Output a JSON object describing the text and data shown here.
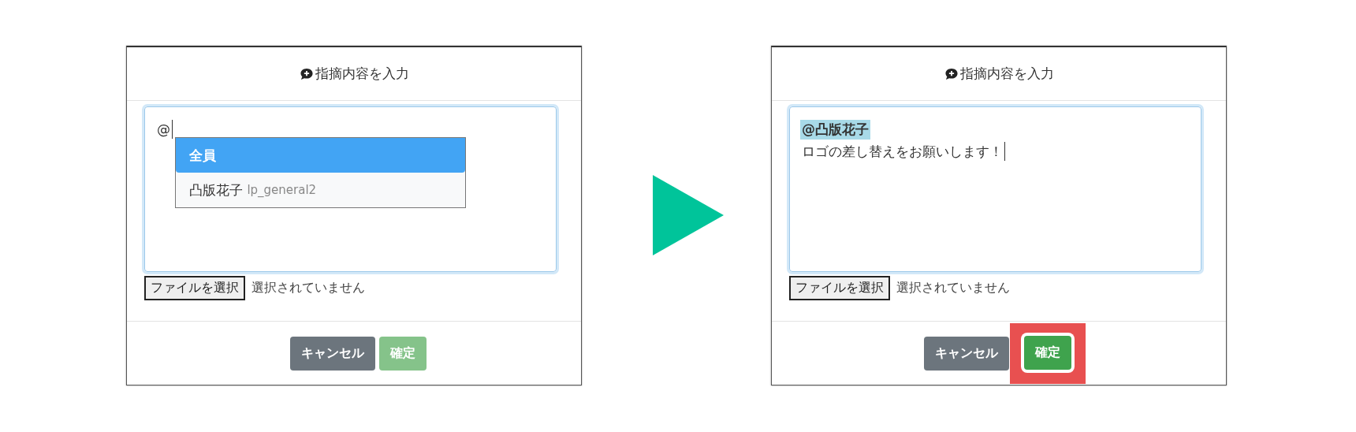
{
  "dialogs": [
    {
      "title": "指摘内容を入力",
      "lines": [
        {
          "kind": "text",
          "text": "@",
          "caret": true
        }
      ],
      "mention_menu": {
        "items": [
          {
            "name": "全員",
            "selected": true
          },
          {
            "name": "凸版花子",
            "user_id": "lp_general2",
            "selected": false
          }
        ]
      },
      "file_input": {
        "button": "ファイルを選択",
        "status": "選択されていません"
      },
      "buttons": [
        {
          "kind": "cancel",
          "label": "キャンセル",
          "disabled": false,
          "highlighted": false
        },
        {
          "kind": "confirm",
          "label": "確定",
          "disabled": true,
          "highlighted": false
        }
      ]
    },
    {
      "title": "指摘内容を入力",
      "lines": [
        {
          "kind": "mention",
          "text": "@凸版花子",
          "caret": false
        },
        {
          "kind": "text",
          "text": "ロゴの差し替えをお願いします！",
          "caret": true
        }
      ],
      "file_input": {
        "button": "ファイルを選択",
        "status": "選択されていません"
      },
      "buttons": [
        {
          "kind": "cancel",
          "label": "キャンセル",
          "disabled": false,
          "highlighted": false
        },
        {
          "kind": "confirm",
          "label": "確定",
          "disabled": false,
          "highlighted": true
        }
      ]
    }
  ]
}
